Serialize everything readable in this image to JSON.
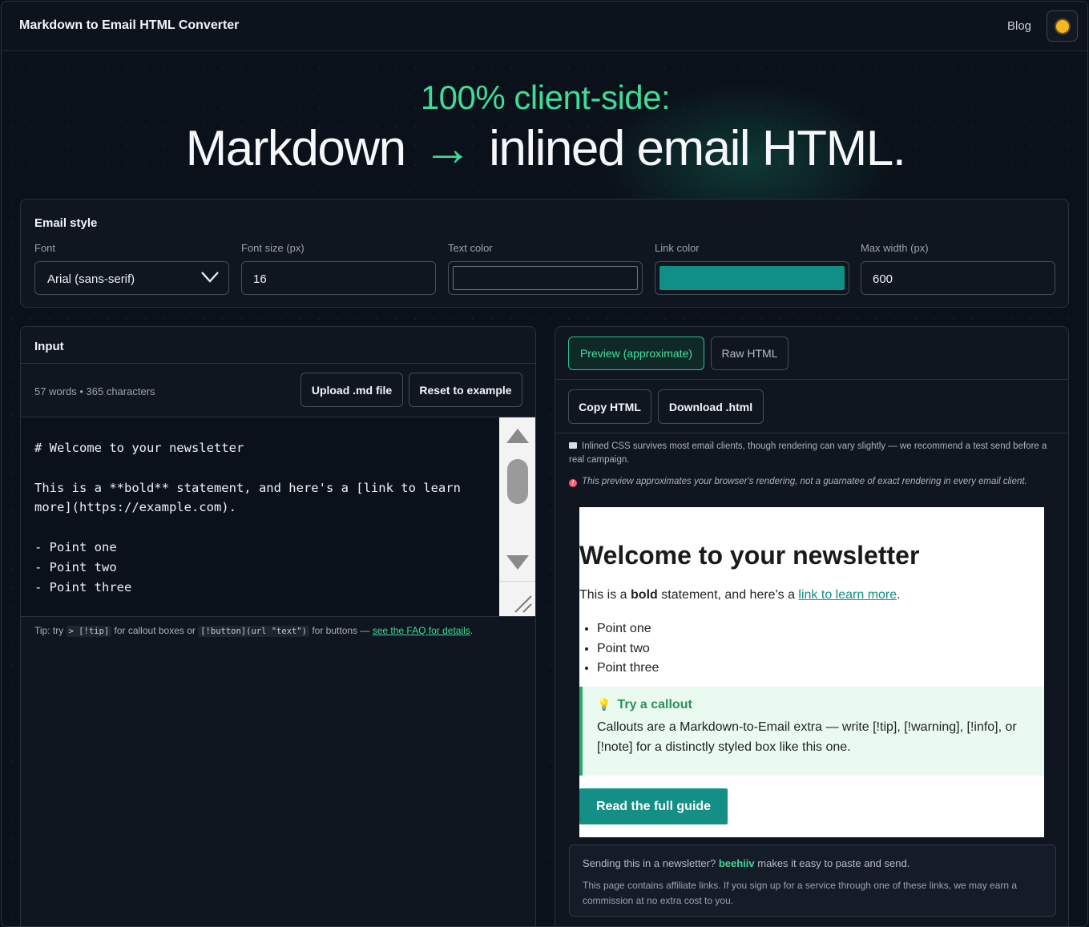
{
  "header": {
    "title": "Markdown to Email HTML Converter",
    "blog_link": "Blog",
    "theme_icon": "sun-icon"
  },
  "hero": {
    "subtitle": "100% client-side:",
    "title_left": "Markdown",
    "title_arrow": "→",
    "title_right": "inlined email HTML."
  },
  "email_style": {
    "title": "Email style",
    "font": {
      "label": "Font",
      "value": "Arial (sans-serif)"
    },
    "font_size": {
      "label": "Font size (px)",
      "value": "16"
    },
    "text_color": {
      "label": "Text color",
      "value": "#0f1620"
    },
    "link_color": {
      "label": "Link color",
      "value": "#0f8f86"
    },
    "max_width": {
      "label": "Max width (px)",
      "value": "600"
    }
  },
  "input": {
    "title": "Input",
    "counts": "57 words • 365 characters",
    "upload_button": "Upload .md file",
    "reset_button": "Reset to example",
    "markdown": "# Welcome to your newsletter\n\nThis is a **bold** statement, and here's a [link to learn more](https://example.com).\n\n- Point one\n- Point two\n- Point three",
    "tip_prefix": "Tip: try",
    "tip_code1": "> [!tip]",
    "tip_middle": "for callout boxes or",
    "tip_code2": "[!button](url \"text\")",
    "tip_suffix": "for buttons —",
    "tip_link": "see the FAQ for details",
    "tip_end": "."
  },
  "output": {
    "tab_preview": "Preview (approximate)",
    "tab_raw": "Raw HTML",
    "copy_button": "Copy HTML",
    "download_button": "Download .html",
    "notice1": "Inlined CSS survives most email clients, though rendering can vary slightly — we recommend a test send before a real campaign.",
    "notice2": "This preview approximates your browser's rendering, not a guarnatee of exact rendering in every email client."
  },
  "preview": {
    "heading": "Welcome to your newsletter",
    "p_before": "This is a",
    "p_bold": "bold",
    "p_middle": "statement, and here's a",
    "p_link": "link to learn more",
    "p_end": ".",
    "list": [
      "Point one",
      "Point two",
      "Point three"
    ],
    "callout_icon": "💡",
    "callout_title": "Try a callout",
    "callout_body": "Callouts are a Markdown-to-Email extra — write [!tip], [!warning], [!info], or [!note] for a distinctly styled box like this one.",
    "button": "Read the full guide"
  },
  "affiliate": {
    "line1_before": "Sending this in a newsletter?",
    "line1_link": "beehiiv",
    "line1_after": "makes it easy to paste and send.",
    "line2": "This page contains affiliate links. If you sign up for a service through one of these links, we may earn a commission at no extra cost to you."
  }
}
